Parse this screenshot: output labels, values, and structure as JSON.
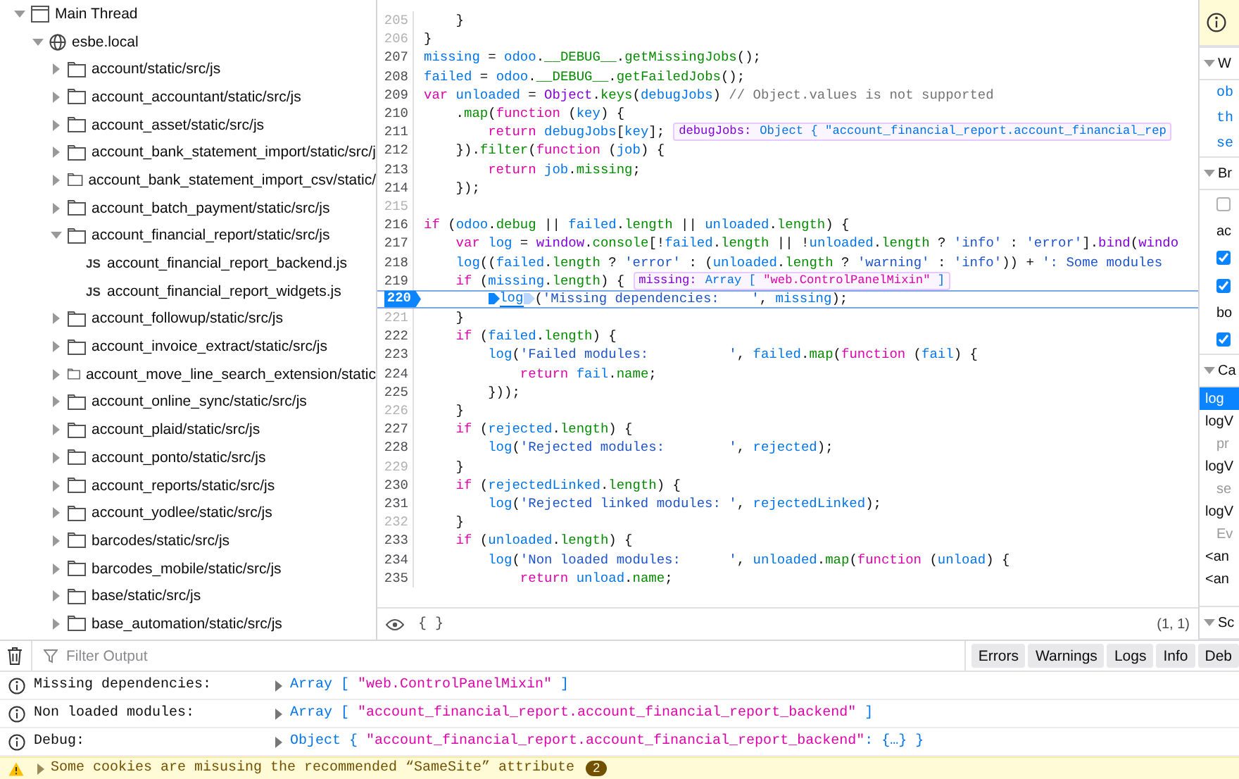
{
  "tree": [
    {
      "label": "Main Thread",
      "kind": "thread",
      "expanded": true,
      "children": [
        {
          "label": "esbe.local",
          "kind": "domain",
          "expanded": true,
          "children": [
            {
              "label": "account/static/src/js",
              "kind": "folder",
              "expanded": false
            },
            {
              "label": "account_accountant/static/src/js",
              "kind": "folder",
              "expanded": false
            },
            {
              "label": "account_asset/static/src/js",
              "kind": "folder",
              "expanded": false
            },
            {
              "label": "account_bank_statement_import/static/src/j",
              "kind": "folder",
              "expanded": false
            },
            {
              "label": "account_bank_statement_import_csv/static/",
              "kind": "folder",
              "expanded": false
            },
            {
              "label": "account_batch_payment/static/src/js",
              "kind": "folder",
              "expanded": false
            },
            {
              "label": "account_financial_report/static/src/js",
              "kind": "folder",
              "expanded": true,
              "children": [
                {
                  "label": "account_financial_report_backend.js",
                  "kind": "file",
                  "badge": "JS"
                },
                {
                  "label": "account_financial_report_widgets.js",
                  "kind": "file",
                  "badge": "JS"
                }
              ]
            },
            {
              "label": "account_followup/static/src/js",
              "kind": "folder",
              "expanded": false
            },
            {
              "label": "account_invoice_extract/static/src/js",
              "kind": "folder",
              "expanded": false
            },
            {
              "label": "account_move_line_search_extension/static",
              "kind": "folder",
              "expanded": false
            },
            {
              "label": "account_online_sync/static/src/js",
              "kind": "folder",
              "expanded": false
            },
            {
              "label": "account_plaid/static/src/js",
              "kind": "folder",
              "expanded": false
            },
            {
              "label": "account_ponto/static/src/js",
              "kind": "folder",
              "expanded": false
            },
            {
              "label": "account_reports/static/src/js",
              "kind": "folder",
              "expanded": false
            },
            {
              "label": "account_yodlee/static/src/js",
              "kind": "folder",
              "expanded": false
            },
            {
              "label": "barcodes/static/src/js",
              "kind": "folder",
              "expanded": false
            },
            {
              "label": "barcodes_mobile/static/src/js",
              "kind": "folder",
              "expanded": false
            },
            {
              "label": "base/static/src/js",
              "kind": "folder",
              "expanded": false
            },
            {
              "label": "base_automation/static/src/js",
              "kind": "folder",
              "expanded": false
            }
          ]
        }
      ]
    }
  ],
  "code": {
    "lines": [
      {
        "number": "205",
        "breakable": false,
        "paused": false,
        "tokens": [
          {
            "kind": "plain",
            "text": "    }"
          }
        ]
      },
      {
        "number": "206",
        "breakable": false,
        "paused": false,
        "tokens": [
          {
            "kind": "plain",
            "text": "}"
          }
        ]
      },
      {
        "number": "207",
        "breakable": true,
        "paused": false,
        "tokens": [
          {
            "kind": "var",
            "text": "missing"
          },
          {
            "kind": "plain",
            "text": " = "
          },
          {
            "kind": "var",
            "text": "odoo"
          },
          {
            "kind": "plain",
            "text": "."
          },
          {
            "kind": "prop",
            "text": "__DEBUG__"
          },
          {
            "kind": "plain",
            "text": "."
          },
          {
            "kind": "prop",
            "text": "getMissingJobs"
          },
          {
            "kind": "plain",
            "text": "();"
          }
        ]
      },
      {
        "number": "208",
        "breakable": true,
        "paused": false,
        "tokens": [
          {
            "kind": "var",
            "text": "failed"
          },
          {
            "kind": "plain",
            "text": " = "
          },
          {
            "kind": "var",
            "text": "odoo"
          },
          {
            "kind": "plain",
            "text": "."
          },
          {
            "kind": "prop",
            "text": "__DEBUG__"
          },
          {
            "kind": "plain",
            "text": "."
          },
          {
            "kind": "prop",
            "text": "getFailedJobs"
          },
          {
            "kind": "plain",
            "text": "();"
          }
        ]
      },
      {
        "number": "209",
        "breakable": true,
        "paused": false,
        "tokens": [
          {
            "kind": "kw",
            "text": "var"
          },
          {
            "kind": "var",
            "text": " unloaded"
          },
          {
            "kind": "plain",
            "text": " = "
          },
          {
            "kind": "obj",
            "text": "Object"
          },
          {
            "kind": "plain",
            "text": "."
          },
          {
            "kind": "prop",
            "text": "keys"
          },
          {
            "kind": "plain",
            "text": "("
          },
          {
            "kind": "var",
            "text": "debugJobs"
          },
          {
            "kind": "plain",
            "text": ")"
          },
          {
            "kind": "comment",
            "text": " // Object.values is not supported"
          }
        ]
      },
      {
        "number": "210",
        "breakable": true,
        "paused": false,
        "tokens": [
          {
            "kind": "plain",
            "text": "    ."
          },
          {
            "kind": "prop",
            "text": "map"
          },
          {
            "kind": "plain",
            "text": "("
          },
          {
            "kind": "kw",
            "text": "function"
          },
          {
            "kind": "plain",
            "text": " ("
          },
          {
            "kind": "var",
            "text": "key"
          },
          {
            "kind": "plain",
            "text": ") {"
          }
        ]
      },
      {
        "number": "211",
        "breakable": true,
        "paused": false,
        "tokens": [
          {
            "kind": "kw",
            "text": "        return"
          },
          {
            "kind": "var",
            "text": " debugJobs"
          },
          {
            "kind": "plain",
            "text": "["
          },
          {
            "kind": "var",
            "text": "key"
          },
          {
            "kind": "plain",
            "text": "];"
          }
        ],
        "preview": {
          "name": "debugJobs:",
          "value": [
            {
              "kind": "type",
              "text": "Object { \"account_financial_report.account_financial_rep"
            }
          ]
        }
      },
      {
        "number": "212",
        "breakable": true,
        "paused": false,
        "tokens": [
          {
            "kind": "plain",
            "text": "    })."
          },
          {
            "kind": "prop",
            "text": "filter"
          },
          {
            "kind": "plain",
            "text": "("
          },
          {
            "kind": "kw",
            "text": "function"
          },
          {
            "kind": "plain",
            "text": " ("
          },
          {
            "kind": "var",
            "text": "job"
          },
          {
            "kind": "plain",
            "text": ") {"
          }
        ]
      },
      {
        "number": "213",
        "breakable": true,
        "paused": false,
        "tokens": [
          {
            "kind": "kw",
            "text": "        return"
          },
          {
            "kind": "var",
            "text": " job"
          },
          {
            "kind": "plain",
            "text": "."
          },
          {
            "kind": "prop",
            "text": "missing"
          },
          {
            "kind": "plain",
            "text": ";"
          }
        ]
      },
      {
        "number": "214",
        "breakable": true,
        "paused": false,
        "tokens": [
          {
            "kind": "plain",
            "text": "    });"
          }
        ]
      },
      {
        "number": "215",
        "breakable": false,
        "paused": false
      },
      {
        "number": "216",
        "breakable": true,
        "paused": false,
        "tokens": [
          {
            "kind": "kw",
            "text": "if"
          },
          {
            "kind": "plain",
            "text": " ("
          },
          {
            "kind": "var",
            "text": "odoo"
          },
          {
            "kind": "plain",
            "text": "."
          },
          {
            "kind": "prop",
            "text": "debug"
          },
          {
            "kind": "plain",
            "text": " || "
          },
          {
            "kind": "var",
            "text": "failed"
          },
          {
            "kind": "plain",
            "text": "."
          },
          {
            "kind": "prop",
            "text": "length"
          },
          {
            "kind": "plain",
            "text": " || "
          },
          {
            "kind": "var",
            "text": "unloaded"
          },
          {
            "kind": "plain",
            "text": "."
          },
          {
            "kind": "prop",
            "text": "length"
          },
          {
            "kind": "plain",
            "text": ") {"
          }
        ]
      },
      {
        "number": "217",
        "breakable": true,
        "paused": false,
        "tokens": [
          {
            "kind": "kw",
            "text": "    var"
          },
          {
            "kind": "var",
            "text": " log"
          },
          {
            "kind": "plain",
            "text": " = "
          },
          {
            "kind": "obj",
            "text": "window"
          },
          {
            "kind": "plain",
            "text": "."
          },
          {
            "kind": "prop",
            "text": "console"
          },
          {
            "kind": "plain",
            "text": "[!"
          },
          {
            "kind": "var",
            "text": "failed"
          },
          {
            "kind": "plain",
            "text": "."
          },
          {
            "kind": "prop",
            "text": "length"
          },
          {
            "kind": "plain",
            "text": " || !"
          },
          {
            "kind": "var",
            "text": "unloaded"
          },
          {
            "kind": "plain",
            "text": "."
          },
          {
            "kind": "prop",
            "text": "length"
          },
          {
            "kind": "plain",
            "text": " ? "
          },
          {
            "kind": "str",
            "text": "'info'"
          },
          {
            "kind": "plain",
            "text": " : "
          },
          {
            "kind": "str",
            "text": "'error'"
          },
          {
            "kind": "plain",
            "text": "]."
          },
          {
            "kind": "obj",
            "text": "bind"
          },
          {
            "kind": "plain",
            "text": "("
          },
          {
            "kind": "obj",
            "text": "windo"
          }
        ]
      },
      {
        "number": "218",
        "breakable": true,
        "paused": false,
        "tokens": [
          {
            "kind": "var",
            "text": "    log"
          },
          {
            "kind": "plain",
            "text": "(("
          },
          {
            "kind": "var",
            "text": "failed"
          },
          {
            "kind": "plain",
            "text": "."
          },
          {
            "kind": "prop",
            "text": "length"
          },
          {
            "kind": "plain",
            "text": " ? "
          },
          {
            "kind": "str",
            "text": "'error'"
          },
          {
            "kind": "plain",
            "text": " : ("
          },
          {
            "kind": "var",
            "text": "unloaded"
          },
          {
            "kind": "plain",
            "text": "."
          },
          {
            "kind": "prop",
            "text": "length"
          },
          {
            "kind": "plain",
            "text": " ? "
          },
          {
            "kind": "str",
            "text": "'warning'"
          },
          {
            "kind": "plain",
            "text": " : "
          },
          {
            "kind": "str",
            "text": "'info'"
          },
          {
            "kind": "plain",
            "text": ")) + "
          },
          {
            "kind": "str",
            "text": "': Some modules"
          }
        ]
      },
      {
        "number": "219",
        "breakable": true,
        "paused": false,
        "tokens": [
          {
            "kind": "kw",
            "text": "    if"
          },
          {
            "kind": "plain",
            "text": " ("
          },
          {
            "kind": "var",
            "text": "missing"
          },
          {
            "kind": "plain",
            "text": "."
          },
          {
            "kind": "prop",
            "text": "length"
          },
          {
            "kind": "plain",
            "text": ") {"
          }
        ],
        "preview": {
          "name": "missing:",
          "value": [
            {
              "kind": "type",
              "text": "Array [ "
            },
            {
              "kind": "string",
              "text": "\"web.ControlPanelMixin\""
            },
            {
              "kind": "type",
              "text": " ]"
            }
          ]
        }
      },
      {
        "number": "220",
        "breakable": true,
        "paused": true,
        "tokens": [
          {
            "kind": "pause",
            "text": "log"
          },
          {
            "kind": "plain",
            "text": "("
          },
          {
            "kind": "str",
            "text": "'Missing dependencies:    '"
          },
          {
            "kind": "plain",
            "text": ", "
          },
          {
            "kind": "var",
            "text": "missing"
          },
          {
            "kind": "plain",
            "text": ");"
          }
        ]
      },
      {
        "number": "221",
        "breakable": false,
        "paused": false,
        "tokens": [
          {
            "kind": "plain",
            "text": "    }"
          }
        ]
      },
      {
        "number": "222",
        "breakable": true,
        "paused": false,
        "tokens": [
          {
            "kind": "kw",
            "text": "    if"
          },
          {
            "kind": "plain",
            "text": " ("
          },
          {
            "kind": "var",
            "text": "failed"
          },
          {
            "kind": "plain",
            "text": "."
          },
          {
            "kind": "prop",
            "text": "length"
          },
          {
            "kind": "plain",
            "text": ") {"
          }
        ]
      },
      {
        "number": "223",
        "breakable": true,
        "paused": false,
        "tokens": [
          {
            "kind": "var",
            "text": "        log"
          },
          {
            "kind": "plain",
            "text": "("
          },
          {
            "kind": "str",
            "text": "'Failed modules:          '"
          },
          {
            "kind": "plain",
            "text": ", "
          },
          {
            "kind": "var",
            "text": "failed"
          },
          {
            "kind": "plain",
            "text": "."
          },
          {
            "kind": "prop",
            "text": "map"
          },
          {
            "kind": "plain",
            "text": "("
          },
          {
            "kind": "kw",
            "text": "function"
          },
          {
            "kind": "plain",
            "text": " ("
          },
          {
            "kind": "var",
            "text": "fail"
          },
          {
            "kind": "plain",
            "text": ") {"
          }
        ]
      },
      {
        "number": "224",
        "breakable": true,
        "paused": false,
        "tokens": [
          {
            "kind": "kw",
            "text": "            return"
          },
          {
            "kind": "var",
            "text": " fail"
          },
          {
            "kind": "plain",
            "text": "."
          },
          {
            "kind": "prop",
            "text": "name"
          },
          {
            "kind": "plain",
            "text": ";"
          }
        ]
      },
      {
        "number": "225",
        "breakable": true,
        "paused": false,
        "tokens": [
          {
            "kind": "plain",
            "text": "        }));"
          }
        ]
      },
      {
        "number": "226",
        "breakable": false,
        "paused": false,
        "tokens": [
          {
            "kind": "plain",
            "text": "    }"
          }
        ]
      },
      {
        "number": "227",
        "breakable": true,
        "paused": false,
        "tokens": [
          {
            "kind": "kw",
            "text": "    if"
          },
          {
            "kind": "plain",
            "text": " ("
          },
          {
            "kind": "var",
            "text": "rejected"
          },
          {
            "kind": "plain",
            "text": "."
          },
          {
            "kind": "prop",
            "text": "length"
          },
          {
            "kind": "plain",
            "text": ") {"
          }
        ]
      },
      {
        "number": "228",
        "breakable": true,
        "paused": false,
        "tokens": [
          {
            "kind": "var",
            "text": "        log"
          },
          {
            "kind": "plain",
            "text": "("
          },
          {
            "kind": "str",
            "text": "'Rejected modules:        '"
          },
          {
            "kind": "plain",
            "text": ", "
          },
          {
            "kind": "var",
            "text": "rejected"
          },
          {
            "kind": "plain",
            "text": ");"
          }
        ]
      },
      {
        "number": "229",
        "breakable": false,
        "paused": false,
        "tokens": [
          {
            "kind": "plain",
            "text": "    }"
          }
        ]
      },
      {
        "number": "230",
        "breakable": true,
        "paused": false,
        "tokens": [
          {
            "kind": "kw",
            "text": "    if"
          },
          {
            "kind": "plain",
            "text": " ("
          },
          {
            "kind": "var",
            "text": "rejectedLinked"
          },
          {
            "kind": "plain",
            "text": "."
          },
          {
            "kind": "prop",
            "text": "length"
          },
          {
            "kind": "plain",
            "text": ") {"
          }
        ]
      },
      {
        "number": "231",
        "breakable": true,
        "paused": false,
        "tokens": [
          {
            "kind": "var",
            "text": "        log"
          },
          {
            "kind": "plain",
            "text": "("
          },
          {
            "kind": "str",
            "text": "'Rejected linked modules: '"
          },
          {
            "kind": "plain",
            "text": ", "
          },
          {
            "kind": "var",
            "text": "rejectedLinked"
          },
          {
            "kind": "plain",
            "text": ");"
          }
        ]
      },
      {
        "number": "232",
        "breakable": false,
        "paused": false,
        "tokens": [
          {
            "kind": "plain",
            "text": "    }"
          }
        ]
      },
      {
        "number": "233",
        "breakable": true,
        "paused": false,
        "tokens": [
          {
            "kind": "kw",
            "text": "    if"
          },
          {
            "kind": "plain",
            "text": " ("
          },
          {
            "kind": "var",
            "text": "unloaded"
          },
          {
            "kind": "plain",
            "text": "."
          },
          {
            "kind": "prop",
            "text": "length"
          },
          {
            "kind": "plain",
            "text": ") {"
          }
        ]
      },
      {
        "number": "234",
        "breakable": true,
        "paused": false,
        "tokens": [
          {
            "kind": "var",
            "text": "        log"
          },
          {
            "kind": "plain",
            "text": "("
          },
          {
            "kind": "str",
            "text": "'Non loaded modules:      '"
          },
          {
            "kind": "plain",
            "text": ", "
          },
          {
            "kind": "var",
            "text": "unloaded"
          },
          {
            "kind": "plain",
            "text": "."
          },
          {
            "kind": "prop",
            "text": "map"
          },
          {
            "kind": "plain",
            "text": "("
          },
          {
            "kind": "kw",
            "text": "function"
          },
          {
            "kind": "plain",
            "text": " ("
          },
          {
            "kind": "var",
            "text": "unload"
          },
          {
            "kind": "plain",
            "text": ") {"
          }
        ]
      },
      {
        "number": "235",
        "breakable": true,
        "paused": false,
        "tokens": [
          {
            "kind": "kw",
            "text": "            return"
          },
          {
            "kind": "var",
            "text": " unload"
          },
          {
            "kind": "plain",
            "text": "."
          },
          {
            "kind": "prop",
            "text": "name"
          },
          {
            "kind": "plain",
            "text": ";"
          }
        ]
      }
    ],
    "footer": {
      "braces": "{ }",
      "position": "(1, 1)"
    }
  },
  "sidebar": [
    {
      "kind": "notice"
    },
    {
      "kind": "header",
      "label": "W"
    },
    {
      "kind": "link",
      "label": "ob"
    },
    {
      "kind": "link",
      "label": "th"
    },
    {
      "kind": "link",
      "label": "se"
    },
    {
      "kind": "header",
      "label": "Br"
    },
    {
      "kind": "checkbox",
      "checked": false
    },
    {
      "kind": "label",
      "label": "ac"
    },
    {
      "kind": "checkbox",
      "checked": true
    },
    {
      "kind": "checkbox",
      "checked": true
    },
    {
      "kind": "label",
      "label": "bo"
    },
    {
      "kind": "checkbox",
      "checked": true
    },
    {
      "kind": "header",
      "label": "Ca"
    },
    {
      "kind": "frame",
      "label": "log",
      "selected": true
    },
    {
      "kind": "frame",
      "label": "logV",
      "selected": false
    },
    {
      "kind": "group",
      "label": "pr"
    },
    {
      "kind": "frame",
      "label": "logV",
      "selected": false
    },
    {
      "kind": "group",
      "label": "se"
    },
    {
      "kind": "frame",
      "label": "logV",
      "selected": false
    },
    {
      "kind": "group",
      "label": "Ev"
    },
    {
      "kind": "frame",
      "label": "<an",
      "selected": false
    },
    {
      "kind": "frame",
      "label": "<an",
      "selected": false
    },
    {
      "kind": "header",
      "label": "Sc"
    }
  ],
  "console": {
    "filter": {
      "placeholder": "Filter Output"
    },
    "buttons": [
      "Errors",
      "Warnings",
      "Logs",
      "Info",
      "Deb"
    ],
    "messages": [
      {
        "kind": "info",
        "label": "Missing dependencies:",
        "value": [
          {
            "kind": "type",
            "text": "Array [ "
          },
          {
            "kind": "string",
            "text": "\"web.ControlPanelMixin\""
          },
          {
            "kind": "type",
            "text": " ]"
          }
        ]
      },
      {
        "kind": "info",
        "label": "Non loaded modules:",
        "value": [
          {
            "kind": "type",
            "text": "Array [ "
          },
          {
            "kind": "string",
            "text": "\"account_financial_report.account_financial_report_backend\""
          },
          {
            "kind": "type",
            "text": " ]"
          }
        ]
      },
      {
        "kind": "info",
        "label": "Debug:",
        "value": [
          {
            "kind": "type",
            "text": "Object { "
          },
          {
            "kind": "string",
            "text": "\"account_financial_report.account_financial_report_backend\""
          },
          {
            "kind": "type",
            "text": ": {…} }"
          }
        ]
      },
      {
        "kind": "warning",
        "label": "Some cookies are misusing the recommended “SameSite” attribute",
        "count": "2"
      }
    ]
  }
}
